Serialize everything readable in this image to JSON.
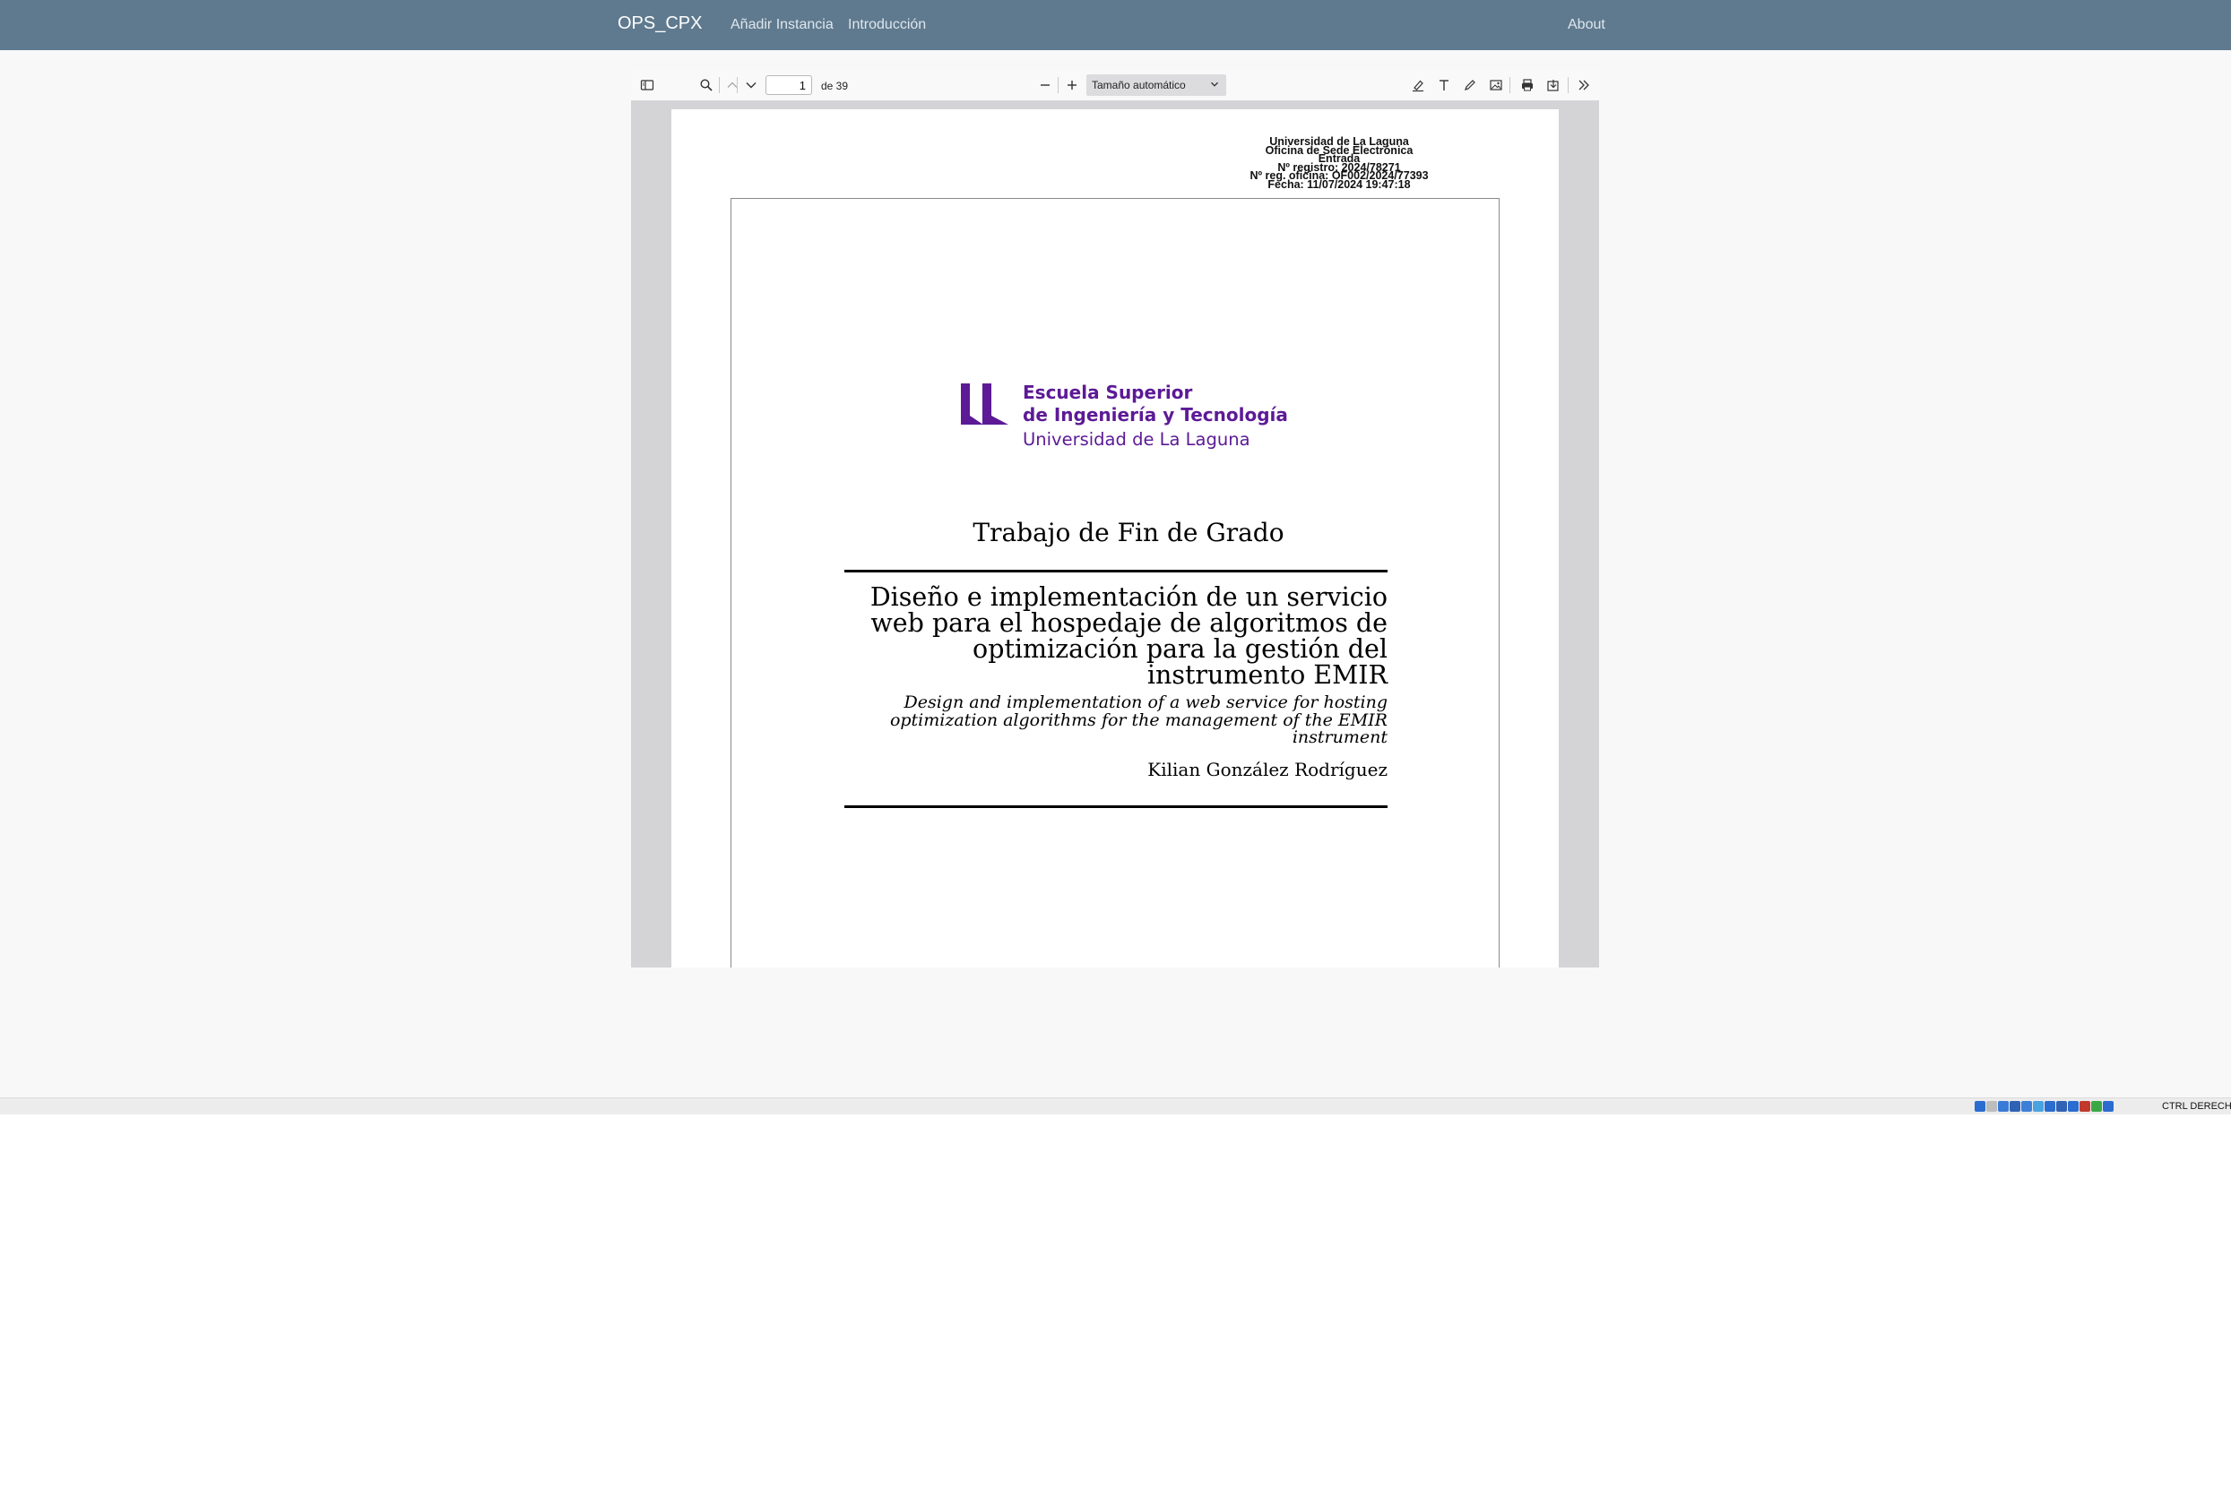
{
  "navbar": {
    "brand": "OPS_CPX",
    "links": [
      "Añadir Instancia",
      "Introducción"
    ],
    "about": "About"
  },
  "pdf_toolbar": {
    "page_number": "1",
    "page_total": "de 39",
    "zoom": "Tamaño automático",
    "icons": [
      "sidebar-toggle-icon",
      "search-icon",
      "previous-page-icon",
      "next-page-icon",
      "zoom-out-icon",
      "zoom-in-icon",
      "highlight-icon",
      "text-icon",
      "draw-icon",
      "image-icon",
      "print-icon",
      "save-icon",
      "more-tools-icon"
    ]
  },
  "document": {
    "stamp": [
      "Universidad de La Laguna",
      "Oficina de Sede Electrónica",
      "Entrada",
      "Nº registro:  2024/78271",
      "Nº reg. oficina: OF002/2024/77393",
      "Fecha:  11/07/2024 19:47:18"
    ],
    "logo": {
      "line1": "Escuela Superior",
      "line2": "de Ingeniería y Tecnología",
      "line3": "Universidad de La Laguna",
      "color": "#5c1a96"
    },
    "heading": "Trabajo de Fin de Grado",
    "title_es": [
      "Diseño e implementación de un servicio",
      "web para el hospedaje de algoritmos de",
      "optimización para la gestión del",
      "instrumento EMIR"
    ],
    "title_en": [
      "Design and implementation of a web service for hosting",
      "optimization algorithms for the management of the EMIR",
      "instrument"
    ],
    "author": "Kilian González Rodríguez"
  },
  "statusbar": {
    "host_key": "CTRL DERECHA",
    "tray_colors": [
      "#2a6ccf",
      "#bdbdbd",
      "#3b7bd8",
      "#2f62b5",
      "#3d7fd6",
      "#4aa3e0",
      "#2a6ccf",
      "#2f62b5",
      "#2a6ccf",
      "#c0392b",
      "#3aa845",
      "#2a6ccf"
    ]
  },
  "colors": {
    "navbar": "#5f7a8f",
    "viewer_bg": "#d4d4d7"
  }
}
